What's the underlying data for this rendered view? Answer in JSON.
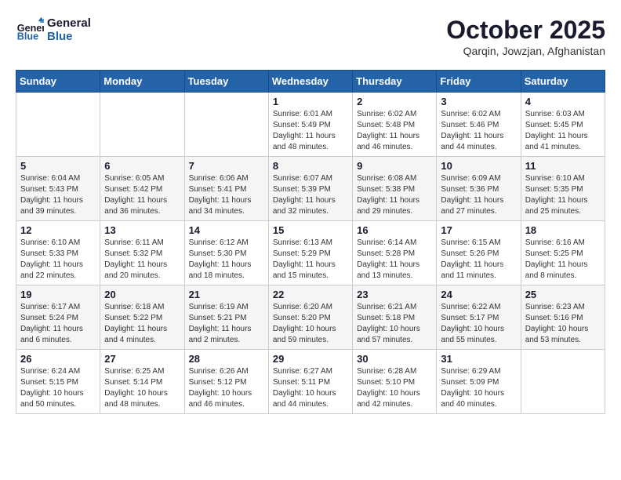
{
  "header": {
    "logo_line1": "General",
    "logo_line2": "Blue",
    "month": "October 2025",
    "location": "Qarqin, Jowzjan, Afghanistan"
  },
  "weekdays": [
    "Sunday",
    "Monday",
    "Tuesday",
    "Wednesday",
    "Thursday",
    "Friday",
    "Saturday"
  ],
  "weeks": [
    [
      {
        "day": "",
        "info": ""
      },
      {
        "day": "",
        "info": ""
      },
      {
        "day": "",
        "info": ""
      },
      {
        "day": "1",
        "info": "Sunrise: 6:01 AM\nSunset: 5:49 PM\nDaylight: 11 hours\nand 48 minutes."
      },
      {
        "day": "2",
        "info": "Sunrise: 6:02 AM\nSunset: 5:48 PM\nDaylight: 11 hours\nand 46 minutes."
      },
      {
        "day": "3",
        "info": "Sunrise: 6:02 AM\nSunset: 5:46 PM\nDaylight: 11 hours\nand 44 minutes."
      },
      {
        "day": "4",
        "info": "Sunrise: 6:03 AM\nSunset: 5:45 PM\nDaylight: 11 hours\nand 41 minutes."
      }
    ],
    [
      {
        "day": "5",
        "info": "Sunrise: 6:04 AM\nSunset: 5:43 PM\nDaylight: 11 hours\nand 39 minutes."
      },
      {
        "day": "6",
        "info": "Sunrise: 6:05 AM\nSunset: 5:42 PM\nDaylight: 11 hours\nand 36 minutes."
      },
      {
        "day": "7",
        "info": "Sunrise: 6:06 AM\nSunset: 5:41 PM\nDaylight: 11 hours\nand 34 minutes."
      },
      {
        "day": "8",
        "info": "Sunrise: 6:07 AM\nSunset: 5:39 PM\nDaylight: 11 hours\nand 32 minutes."
      },
      {
        "day": "9",
        "info": "Sunrise: 6:08 AM\nSunset: 5:38 PM\nDaylight: 11 hours\nand 29 minutes."
      },
      {
        "day": "10",
        "info": "Sunrise: 6:09 AM\nSunset: 5:36 PM\nDaylight: 11 hours\nand 27 minutes."
      },
      {
        "day": "11",
        "info": "Sunrise: 6:10 AM\nSunset: 5:35 PM\nDaylight: 11 hours\nand 25 minutes."
      }
    ],
    [
      {
        "day": "12",
        "info": "Sunrise: 6:10 AM\nSunset: 5:33 PM\nDaylight: 11 hours\nand 22 minutes."
      },
      {
        "day": "13",
        "info": "Sunrise: 6:11 AM\nSunset: 5:32 PM\nDaylight: 11 hours\nand 20 minutes."
      },
      {
        "day": "14",
        "info": "Sunrise: 6:12 AM\nSunset: 5:30 PM\nDaylight: 11 hours\nand 18 minutes."
      },
      {
        "day": "15",
        "info": "Sunrise: 6:13 AM\nSunset: 5:29 PM\nDaylight: 11 hours\nand 15 minutes."
      },
      {
        "day": "16",
        "info": "Sunrise: 6:14 AM\nSunset: 5:28 PM\nDaylight: 11 hours\nand 13 minutes."
      },
      {
        "day": "17",
        "info": "Sunrise: 6:15 AM\nSunset: 5:26 PM\nDaylight: 11 hours\nand 11 minutes."
      },
      {
        "day": "18",
        "info": "Sunrise: 6:16 AM\nSunset: 5:25 PM\nDaylight: 11 hours\nand 8 minutes."
      }
    ],
    [
      {
        "day": "19",
        "info": "Sunrise: 6:17 AM\nSunset: 5:24 PM\nDaylight: 11 hours\nand 6 minutes."
      },
      {
        "day": "20",
        "info": "Sunrise: 6:18 AM\nSunset: 5:22 PM\nDaylight: 11 hours\nand 4 minutes."
      },
      {
        "day": "21",
        "info": "Sunrise: 6:19 AM\nSunset: 5:21 PM\nDaylight: 11 hours\nand 2 minutes."
      },
      {
        "day": "22",
        "info": "Sunrise: 6:20 AM\nSunset: 5:20 PM\nDaylight: 10 hours\nand 59 minutes."
      },
      {
        "day": "23",
        "info": "Sunrise: 6:21 AM\nSunset: 5:18 PM\nDaylight: 10 hours\nand 57 minutes."
      },
      {
        "day": "24",
        "info": "Sunrise: 6:22 AM\nSunset: 5:17 PM\nDaylight: 10 hours\nand 55 minutes."
      },
      {
        "day": "25",
        "info": "Sunrise: 6:23 AM\nSunset: 5:16 PM\nDaylight: 10 hours\nand 53 minutes."
      }
    ],
    [
      {
        "day": "26",
        "info": "Sunrise: 6:24 AM\nSunset: 5:15 PM\nDaylight: 10 hours\nand 50 minutes."
      },
      {
        "day": "27",
        "info": "Sunrise: 6:25 AM\nSunset: 5:14 PM\nDaylight: 10 hours\nand 48 minutes."
      },
      {
        "day": "28",
        "info": "Sunrise: 6:26 AM\nSunset: 5:12 PM\nDaylight: 10 hours\nand 46 minutes."
      },
      {
        "day": "29",
        "info": "Sunrise: 6:27 AM\nSunset: 5:11 PM\nDaylight: 10 hours\nand 44 minutes."
      },
      {
        "day": "30",
        "info": "Sunrise: 6:28 AM\nSunset: 5:10 PM\nDaylight: 10 hours\nand 42 minutes."
      },
      {
        "day": "31",
        "info": "Sunrise: 6:29 AM\nSunset: 5:09 PM\nDaylight: 10 hours\nand 40 minutes."
      },
      {
        "day": "",
        "info": ""
      }
    ]
  ]
}
